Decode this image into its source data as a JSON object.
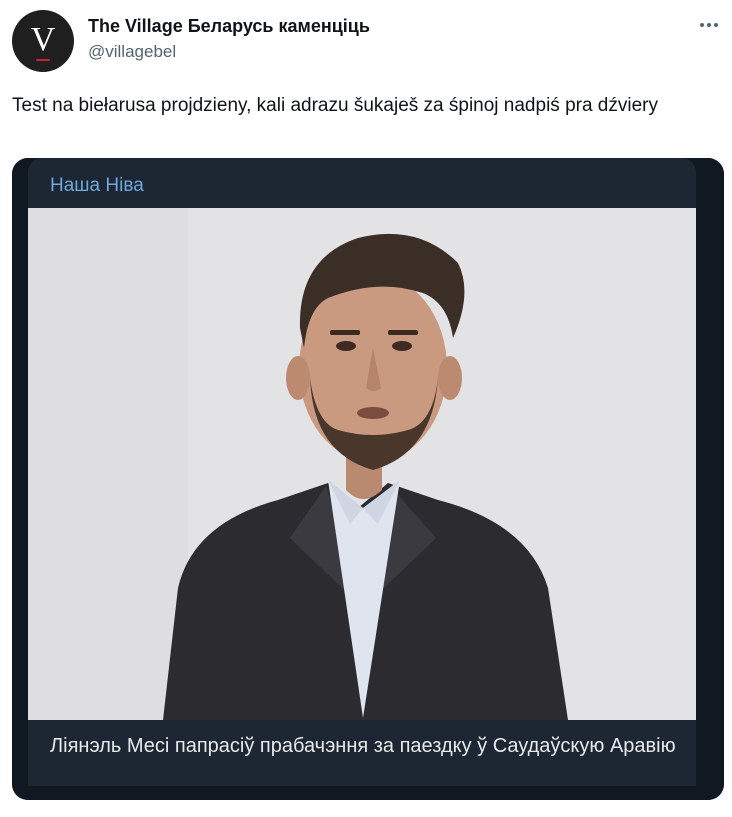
{
  "tweet": {
    "author": {
      "display_name": "The Village Беларусь каменціць",
      "handle": "@villagebel",
      "avatar_letter": "V"
    },
    "more_icon": "more-horizontal-icon",
    "text": "Test na biełarusa projdzieny, kali adrazu šukaješ za śpinoj nadpiś pra dźviery",
    "media": {
      "source_label": "Наша Ніва",
      "caption": "Лiянэль Месі папрасіў прабачэння за паездку ў Саудаўскую Аравію"
    }
  },
  "colors": {
    "text_primary": "#0f1419",
    "text_secondary": "#536471",
    "card_dark": "#1c2733",
    "source_link": "#6fa8dc"
  }
}
